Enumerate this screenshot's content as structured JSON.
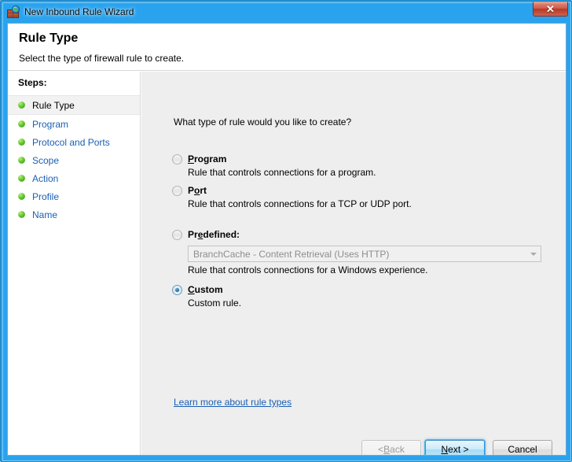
{
  "window": {
    "title": "New Inbound Rule Wizard",
    "icon": "firewall-wall-globe-icon",
    "close_label": "✕"
  },
  "header": {
    "title": "Rule Type",
    "subtitle": "Select the type of firewall rule to create."
  },
  "sidebar": {
    "heading": "Steps:",
    "items": [
      {
        "label": "Rule Type",
        "current": true
      },
      {
        "label": "Program",
        "current": false
      },
      {
        "label": "Protocol and Ports",
        "current": false
      },
      {
        "label": "Scope",
        "current": false
      },
      {
        "label": "Action",
        "current": false
      },
      {
        "label": "Profile",
        "current": false
      },
      {
        "label": "Name",
        "current": false
      }
    ]
  },
  "main": {
    "question": "What type of rule would you like to create?",
    "options": [
      {
        "id": "program",
        "label_pre": "",
        "label_accel": "P",
        "label_post": "rogram",
        "description": "Rule that controls connections for a program.",
        "selected": false
      },
      {
        "id": "port",
        "label_pre": "P",
        "label_accel": "o",
        "label_post": "rt",
        "description": "Rule that controls connections for a TCP or UDP port.",
        "selected": false
      },
      {
        "id": "predefined",
        "label_pre": "Pr",
        "label_accel": "e",
        "label_post": "defined:",
        "description": "Rule that controls connections for a Windows experience.",
        "selected": false
      },
      {
        "id": "custom",
        "label_pre": "",
        "label_accel": "C",
        "label_post": "ustom",
        "description": "Custom rule.",
        "selected": true
      }
    ],
    "predefined_combo": {
      "value": "BranchCache - Content Retrieval (Uses HTTP)",
      "enabled": false
    },
    "learn_more_link": "Learn more about rule types"
  },
  "buttons": {
    "back": {
      "pre": "< ",
      "accel": "B",
      "post": "ack",
      "enabled": false
    },
    "next": {
      "pre": "",
      "accel": "N",
      "post": "ext >",
      "default": true
    },
    "cancel": {
      "pre": "Cancel",
      "accel": "",
      "post": "",
      "enabled": true
    }
  },
  "colors": {
    "frame_blue": "#2aa3ee",
    "link_blue": "#1a5fb4",
    "panel_gray": "#eeeeee",
    "close_red": "#cf5b48",
    "bullet_green": "#5fc42a"
  }
}
